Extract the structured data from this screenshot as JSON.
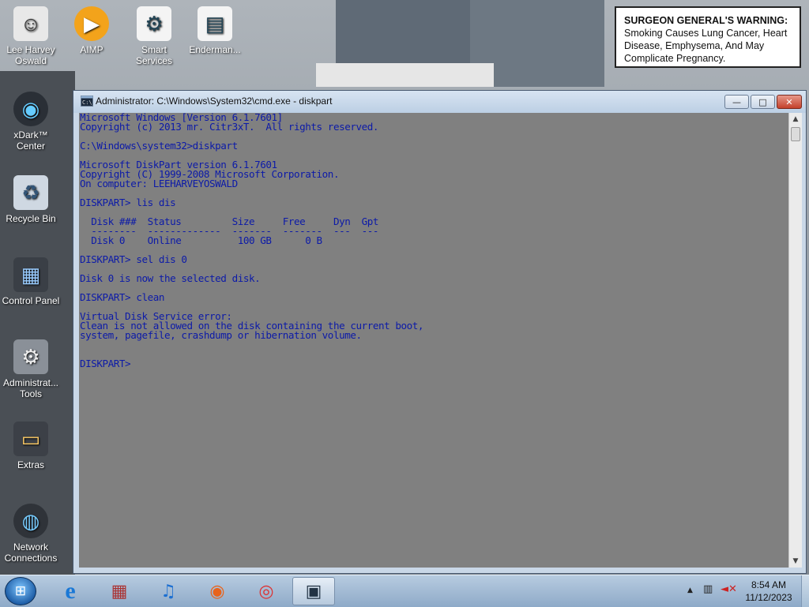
{
  "billboard": {
    "warning_head": "SURGEON GENERAL'S WARNING:",
    "warning_text": "Smoking Causes Lung Cancer, Heart Disease, Emphysema, And May Complicate Pregnancy."
  },
  "desktop_icons": [
    {
      "label": "Lee Harvey Oswald",
      "icon": "user-icon"
    },
    {
      "label": "AIMP",
      "icon": "aimp-icon"
    },
    {
      "label": "Smart Services",
      "icon": "services-icon"
    },
    {
      "label": "Enderman...",
      "icon": "shortcut-icon"
    },
    {
      "label": "xDark™ Center",
      "icon": "xdark-icon"
    },
    {
      "label": "Recycle Bin",
      "icon": "recycle-bin-icon"
    },
    {
      "label": "Control Panel",
      "icon": "control-panel-icon"
    },
    {
      "label": "Administrat... Tools",
      "icon": "admin-tools-icon"
    },
    {
      "label": "Extras",
      "icon": "folder-icon"
    },
    {
      "label": "Network Connections",
      "icon": "network-icon"
    }
  ],
  "window": {
    "title": "Administrator: C:\\Windows\\System32\\cmd.exe - diskpart",
    "min_glyph": "—",
    "max_glyph": "□",
    "close_glyph": "✕"
  },
  "console_lines": [
    "Microsoft Windows [Version 6.1.7601]",
    "Copyright (c) 2013 mr. Citr3xT.  All rights reserved.",
    "",
    "C:\\Windows\\system32>diskpart",
    "",
    "Microsoft DiskPart version 6.1.7601",
    "Copyright (C) 1999-2008 Microsoft Corporation.",
    "On computer: LEEHARVEYOSWALD",
    "",
    "DISKPART> lis dis",
    "",
    "  Disk ###  Status         Size     Free     Dyn  Gpt",
    "  --------  -------------  -------  -------  ---  ---",
    "  Disk 0    Online          100 GB      0 B",
    "",
    "DISKPART> sel dis 0",
    "",
    "Disk 0 is now the selected disk.",
    "",
    "DISKPART> clean",
    "",
    "Virtual Disk Service error:",
    "Clean is not allowed on the disk containing the current boot,",
    "system, pagefile, crashdump or hibernation volume.",
    "",
    "",
    "DISKPART> "
  ],
  "taskbar": {
    "apps": [
      {
        "name": "internet-explorer",
        "glyph": "e"
      },
      {
        "name": "archive-app",
        "glyph": "▦"
      },
      {
        "name": "music-player",
        "glyph": "♫"
      },
      {
        "name": "firefox",
        "glyph": "◉"
      },
      {
        "name": "chrome",
        "glyph": "◎"
      },
      {
        "name": "cmd",
        "glyph": "▣"
      }
    ],
    "time": "8:54 AM",
    "date": "11/12/2023"
  },
  "colors": {
    "console_bg": "#808080",
    "console_text": "#0c1aa8"
  }
}
